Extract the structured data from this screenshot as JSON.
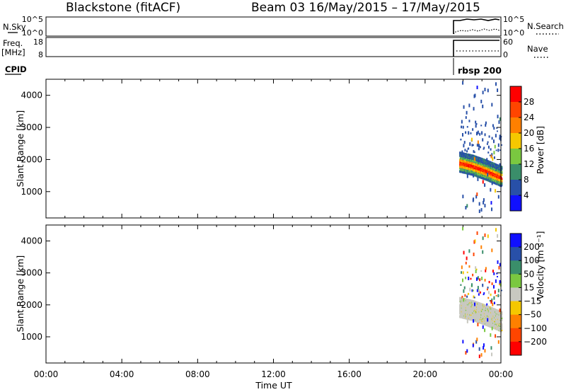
{
  "header": {
    "station": "Blackstone (fitACF)",
    "beam_date": "Beam 03 16/May/2015 – 17/May/2015"
  },
  "top_panels": {
    "nsky_label": "N.Sky",
    "nsky_ticks": [
      "10^5",
      "10^0"
    ],
    "nsearch_label": "N.Search",
    "nsearch_ticks": [
      "10^5",
      "10^0"
    ],
    "freq_label_line1": "Freq.",
    "freq_label_line2": "[MHz]",
    "freq_ticks": [
      "18",
      "8"
    ],
    "nave_label": "Nave",
    "nave_ticks": [
      "60",
      "0"
    ],
    "cpid_label": "CPID",
    "cpid_value": "rbsp 200"
  },
  "chart_data": [
    {
      "type": "heatmap",
      "id": "power",
      "ylabel": "Slant Range [km]",
      "yticks": [
        1000,
        2000,
        3000,
        4000
      ],
      "ylim": [
        180,
        4500
      ],
      "xlim": [
        0,
        24
      ],
      "data_start_hour": 21.8,
      "colorbar_label": "Power [dB]",
      "colorbar_ticks": [
        "4",
        "8",
        "12",
        "16",
        "20",
        "24",
        "28"
      ],
      "colors": [
        "#1010ff",
        "#2850a8",
        "#3a8e6a",
        "#7ac840",
        "#f5c800",
        "#ff8000",
        "#ff4500",
        "#ff0000"
      ],
      "series": [
        {
          "name": "band_center_km",
          "x": [
            21.8,
            22.5,
            23.2,
            24.0
          ],
          "values": [
            1900,
            1800,
            1650,
            1450
          ]
        }
      ]
    },
    {
      "type": "heatmap",
      "id": "velocity",
      "ylabel": "Slant Range [km]",
      "yticks": [
        1000,
        2000,
        3000,
        4000
      ],
      "ylim": [
        180,
        4500
      ],
      "xlim": [
        0,
        24
      ],
      "data_start_hour": 21.8,
      "colorbar_label": "Velocity [m s⁻¹]",
      "colorbar_ticks": [
        "200",
        "100",
        "50",
        "15",
        "−15",
        "−50",
        "−100",
        "−200"
      ],
      "colors": [
        "#1010ff",
        "#2850a8",
        "#3a8e6a",
        "#7ac840",
        "#c8c8c0",
        "#f5c800",
        "#ff8000",
        "#ff4500",
        "#ff0000"
      ]
    }
  ],
  "xaxis": {
    "ticks": [
      "00:00",
      "04:00",
      "08:00",
      "12:00",
      "16:00",
      "20:00",
      "00:00"
    ],
    "label": "Time UT"
  }
}
